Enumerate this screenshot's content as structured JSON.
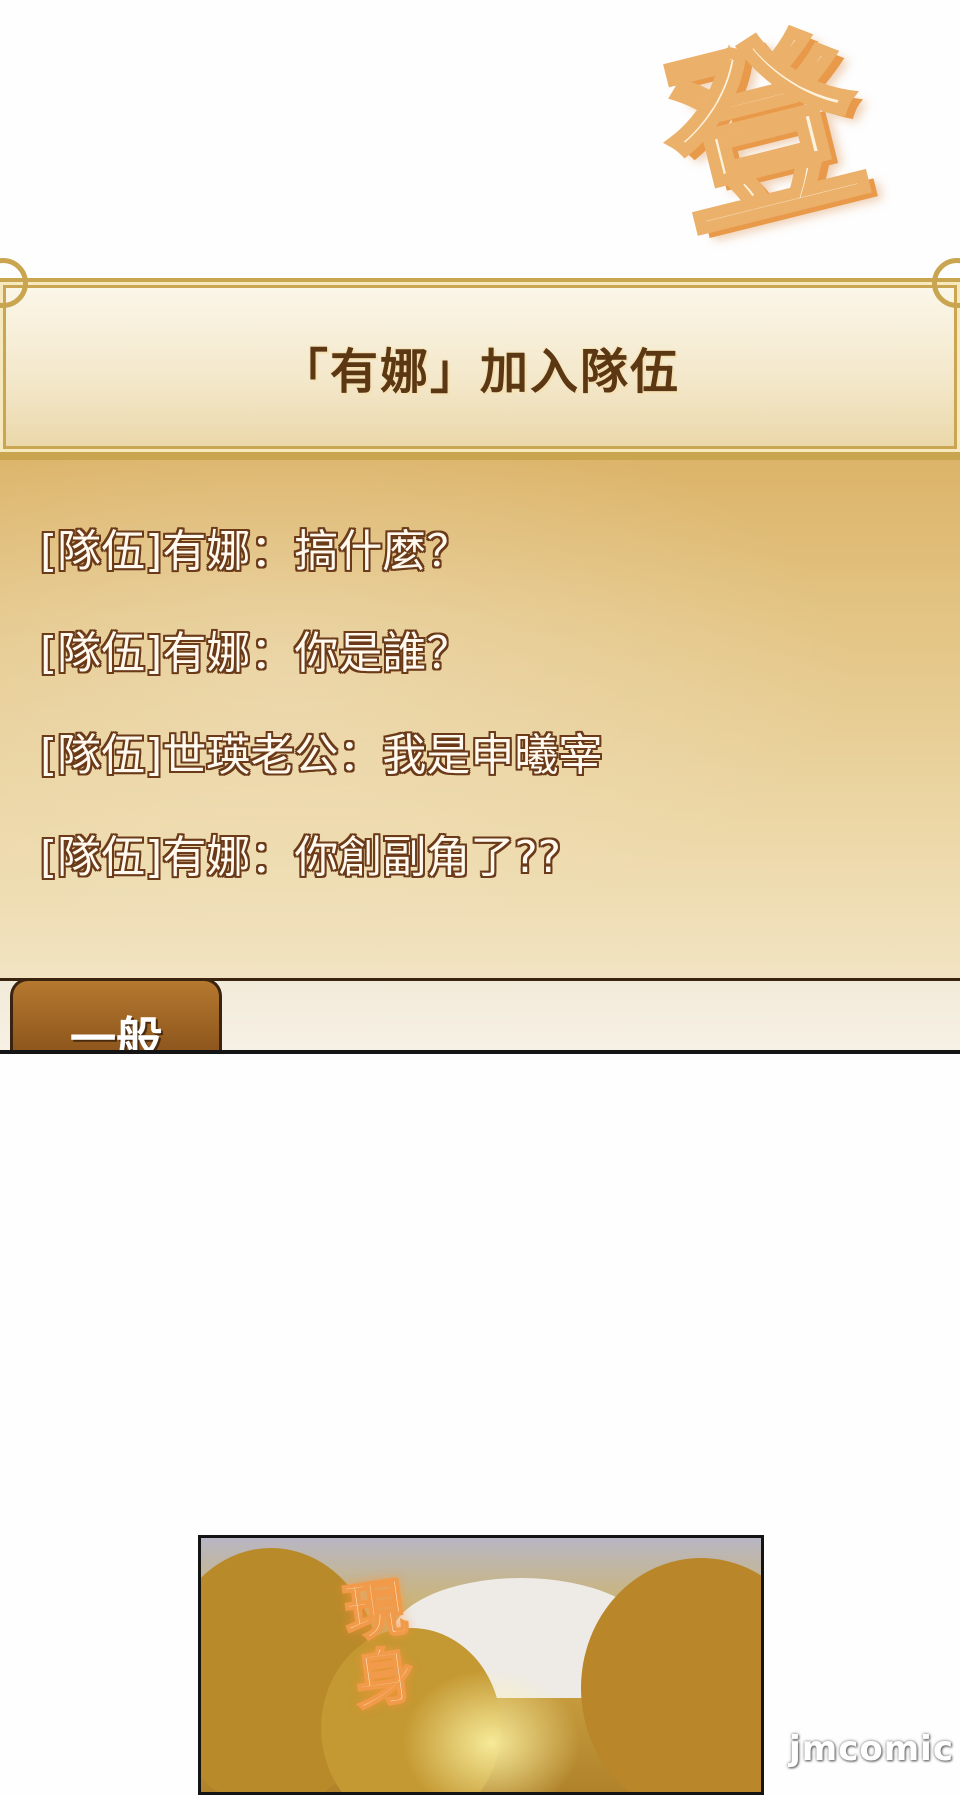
{
  "sfx_top": "登",
  "banner": {
    "title": "「有娜」加入隊伍"
  },
  "chat": {
    "lines": [
      "[隊伍]有娜：搞什麼？",
      "[隊伍]有娜：你是誰？",
      "[隊伍]世瑛老公：我是申曦宰",
      "[隊伍]有娜：你創副角了??"
    ],
    "active_tab": "一般"
  },
  "sfx_bottom": "現身",
  "watermark": "jmcomic",
  "colors": {
    "banner_text": "#5b3714",
    "chat_text": "#fff9ef",
    "chat_outline": "#6b3a18",
    "frame_gold": "#c9a54f",
    "tab_brown": "#a06a28"
  }
}
